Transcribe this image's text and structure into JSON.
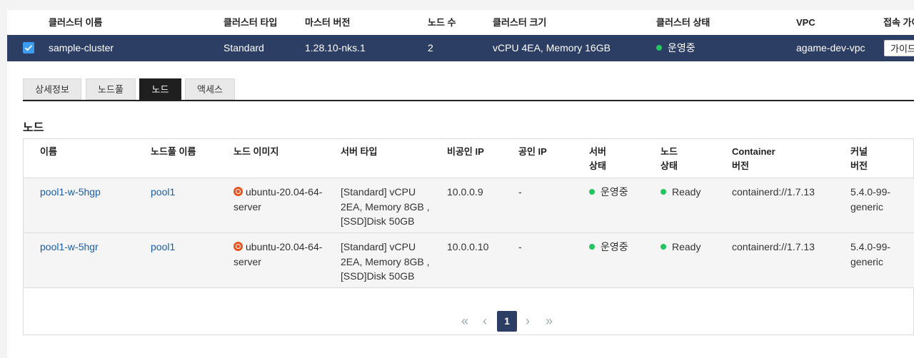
{
  "cluster_table": {
    "headers": {
      "name": "클러스터 이름",
      "type": "클러스터 타입",
      "master_version": "마스터 버전",
      "node_count": "노드 수",
      "size": "클러스터 크기",
      "status": "클러스터 상태",
      "vpc": "VPC",
      "access": "접속 가이드"
    },
    "row": {
      "name": "sample-cluster",
      "type": "Standard",
      "master_version": "1.28.10-nks.1",
      "node_count": "2",
      "size": "vCPU 4EA, Memory 16GB",
      "status": "운영중",
      "vpc": "agame-dev-vpc",
      "guide_button": "가이드"
    }
  },
  "tabs": [
    "상세정보",
    "노드풀",
    "노드",
    "액세스"
  ],
  "active_tab": "노드",
  "section_title": "노드",
  "node_table": {
    "headers": {
      "name": "이름",
      "pool": "노드풀 이름",
      "image": "노드 이미지",
      "server_type": "서버 타입",
      "private_ip": "비공인 IP",
      "public_ip": "공인 IP",
      "server_status_1": "서버",
      "server_status_2": "상태",
      "node_status_1": "노드",
      "node_status_2": "상태",
      "container_1": "Container",
      "container_2": "버전",
      "kernel_1": "커널",
      "kernel_2": "버전"
    },
    "rows": [
      {
        "name": "pool1-w-5hgp",
        "pool": "pool1",
        "image_1": "ubuntu-20.04-64-",
        "image_2": "server",
        "server_type_1": "[Standard] vCPU",
        "server_type_2": "2EA, Memory 8GB ,",
        "server_type_3": "[SSD]Disk 50GB",
        "private_ip": "10.0.0.9",
        "public_ip": "-",
        "server_status": "운영중",
        "node_status": "Ready",
        "container": "containerd://1.7.13",
        "kernel_1": "5.4.0-99-",
        "kernel_2": "generic"
      },
      {
        "name": "pool1-w-5hgr",
        "pool": "pool1",
        "image_1": "ubuntu-20.04-64-",
        "image_2": "server",
        "server_type_1": "[Standard] vCPU",
        "server_type_2": "2EA, Memory 8GB ,",
        "server_type_3": "[SSD]Disk 50GB",
        "private_ip": "10.0.0.10",
        "public_ip": "-",
        "server_status": "운영중",
        "node_status": "Ready",
        "container": "containerd://1.7.13",
        "kernel_1": "5.4.0-99-",
        "kernel_2": "generic"
      }
    ]
  },
  "pagination": {
    "current": "1",
    "first": "«",
    "prev": "‹",
    "next": "›",
    "last": "»"
  },
  "colors": {
    "header_row": "#2c3e63",
    "status_green": "#22c55e",
    "link": "#1a5ea8",
    "active_tab": "#1f1f1f"
  }
}
